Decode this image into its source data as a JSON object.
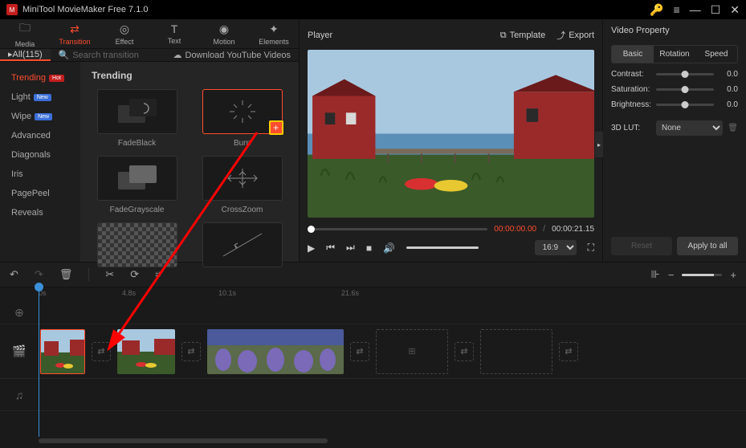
{
  "app": {
    "title": "MiniTool MovieMaker Free 7.1.0"
  },
  "toolbar": {
    "media": "Media",
    "transition": "Transition",
    "effect": "Effect",
    "text": "Text",
    "motion": "Motion",
    "elements": "Elements"
  },
  "subheader": {
    "all_count": "All(115)",
    "search_placeholder": "Search transition",
    "download": "Download YouTube Videos"
  },
  "sidebar": {
    "items": [
      {
        "label": "Trending",
        "badge": "Hot",
        "badge_class": "hot",
        "active": true
      },
      {
        "label": "Light",
        "badge": "New",
        "badge_class": "new"
      },
      {
        "label": "Wipe",
        "badge": "New",
        "badge_class": "new"
      },
      {
        "label": "Advanced"
      },
      {
        "label": "Diagonals"
      },
      {
        "label": "Iris"
      },
      {
        "label": "PagePeel"
      },
      {
        "label": "Reveals"
      }
    ]
  },
  "grid": {
    "title": "Trending",
    "items": [
      {
        "label": "FadeBlack"
      },
      {
        "label": "Burn"
      },
      {
        "label": "FadeGrayscale"
      },
      {
        "label": "CrossZoom"
      }
    ]
  },
  "player": {
    "title": "Player",
    "template": "Template",
    "export": "Export",
    "time_now": "00:00:00.00",
    "time_total": "00:00:21.15",
    "aspect": "16:9"
  },
  "props": {
    "title": "Video Property",
    "tabs": {
      "basic": "Basic",
      "rotation": "Rotation",
      "speed": "Speed"
    },
    "contrast": {
      "label": "Contrast:",
      "val": "0.0"
    },
    "saturation": {
      "label": "Saturation:",
      "val": "0.0"
    },
    "brightness": {
      "label": "Brightness:",
      "val": "0.0"
    },
    "lut": {
      "label": "3D LUT:",
      "val": "None"
    },
    "reset": "Reset",
    "apply": "Apply to all"
  },
  "timeline": {
    "marks": [
      "0s",
      "4.8s",
      "10.1s",
      "21.6s"
    ]
  }
}
